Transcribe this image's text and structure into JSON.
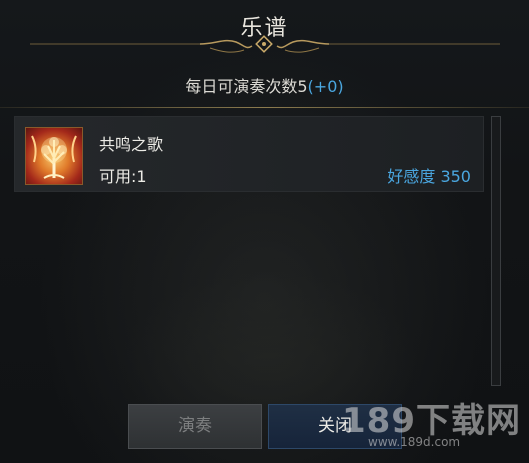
{
  "dialog": {
    "title": "乐谱",
    "count_label": "每日可演奏次数5",
    "count_bonus": "(+0)"
  },
  "items": [
    {
      "name": "共鸣之歌",
      "usable": "可用:1",
      "affinity": "好感度 350",
      "icon": "golden-tree-icon"
    }
  ],
  "buttons": {
    "play": "演奏",
    "close": "关闭"
  },
  "watermark": {
    "main": "189下载网",
    "sub": "www.189d.com"
  },
  "colors": {
    "accent_blue": "#4aa6df",
    "gold_ornament": "#b89a5e",
    "text": "#ecebe6"
  }
}
